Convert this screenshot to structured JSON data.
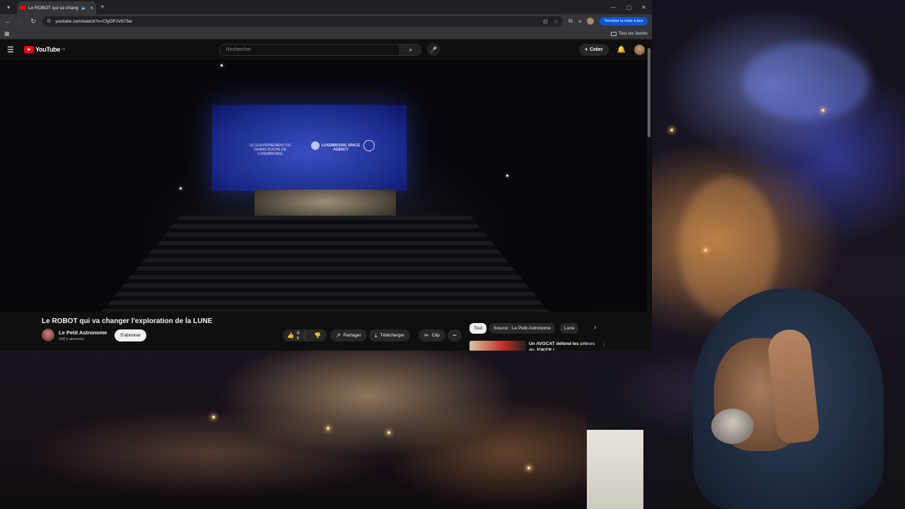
{
  "browser": {
    "tab": {
      "title": "Le ROBOT qui va changer l'",
      "audio_icon": "speaker-icon",
      "close": "×"
    },
    "new_tab": "+",
    "window_controls": {
      "minimize": "—",
      "maximize": "▢",
      "close": "✕"
    },
    "url": "youtube.com/watch?v=CfyDPJV675w",
    "update_button": "Terminer la mise à jour",
    "bookmarks": {
      "all_label": "Tous les favoris"
    }
  },
  "youtube": {
    "logo_text": "YouTube",
    "country_code": "FR",
    "search_placeholder": "Rechercher",
    "create_label": "Créer",
    "video": {
      "title": "Le ROBOT qui va changer l'exploration de la LUNE",
      "screen_text": {
        "left": "LE GOUVERNEMENT DU GRAND-DUCHÉ DE LUXEMBOURG",
        "center": "LUXEMBOURG SPACE AGENCY"
      }
    },
    "channel": {
      "name": "Le Petit Astronome",
      "subscribers": "248 k abonnés",
      "subscribe_label": "S'abonner"
    },
    "actions": {
      "likes": "6 k",
      "share": "Partager",
      "download": "Télécharger",
      "clip": "Clip",
      "more": "•••"
    },
    "chips": [
      "Tout",
      "Source : Le Petit Astronome",
      "Lune"
    ],
    "recommendation": {
      "title": "Un AVOCAT défend les crimes du JOKER !"
    }
  },
  "colors": {
    "yt_red": "#ff0000",
    "update_blue": "#0b57d0",
    "dark_bg": "#0f0f0f"
  }
}
